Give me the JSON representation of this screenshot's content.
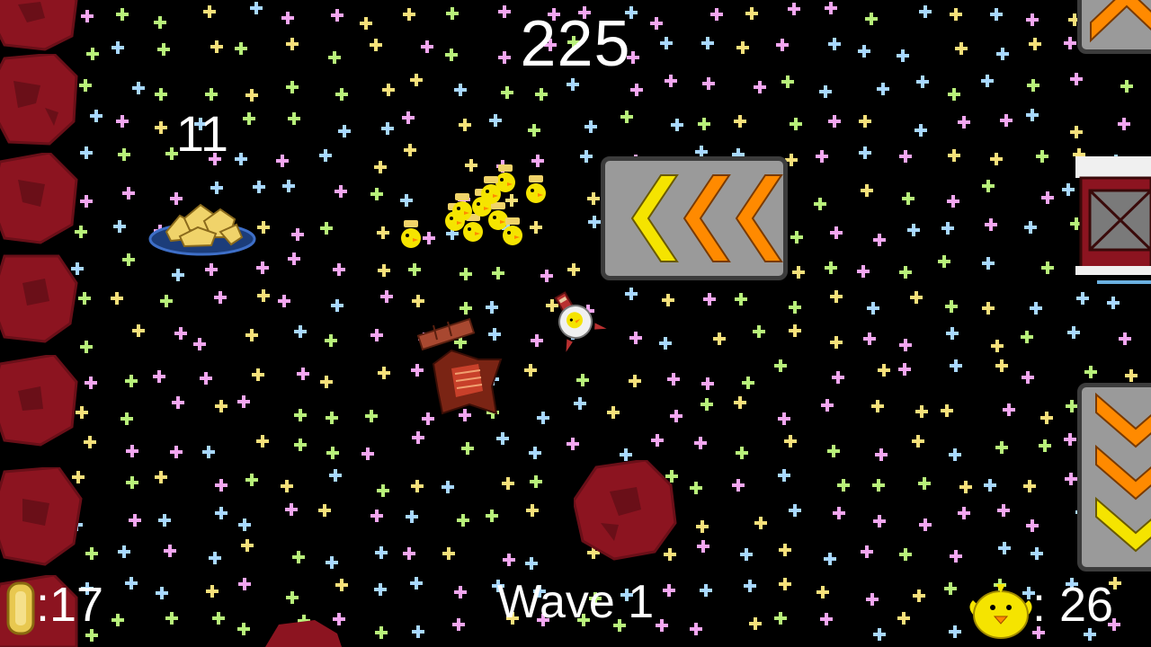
{
  "hud": {
    "score": "225",
    "plate_count": "11",
    "wave": "Wave 1",
    "coins": ":17",
    "chicks": ": 26"
  },
  "icons": {
    "coin": "coin-icon",
    "chick": "chick-icon",
    "plate": "food-plate-icon",
    "player": "player-chicken-ship",
    "enemy": "wrecked-enemy-ship",
    "barn": "barn-icon",
    "arrow_left": "chevron-left-arrows-icon",
    "arrow_down": "chevron-down-arrows-icon",
    "arrow_up": "chevron-up-arrows-icon",
    "asteroid": "asteroid-icon"
  },
  "colors": {
    "background": "#000000",
    "asteroid": "#8c1420",
    "arrow_yellow": "#f5e400",
    "arrow_orange": "#ff8a00",
    "panel": "#9a9a9a",
    "text": "#ffffff"
  }
}
